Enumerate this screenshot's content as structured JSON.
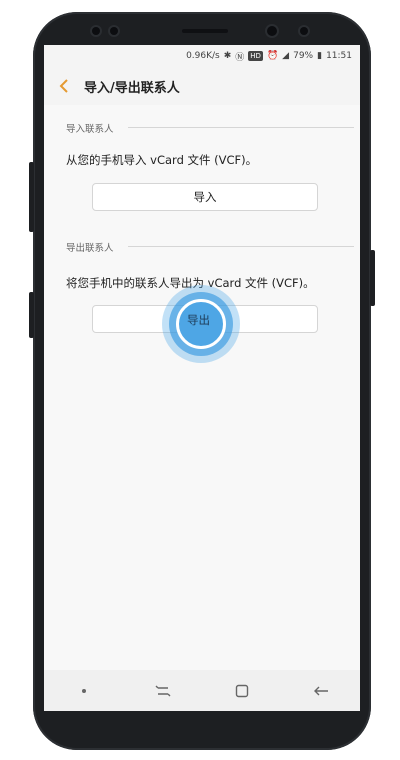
{
  "status_bar": {
    "speed": "0.96K/s",
    "battery": "79%",
    "time": "11:51",
    "hd_badge": "HD",
    "icons": [
      "bluetooth-icon",
      "nfc-icon",
      "hd-icon",
      "alarm-icon",
      "signal-icon",
      "battery-icon"
    ]
  },
  "header": {
    "title": "导入/导出联系人",
    "accent": "#e59a32"
  },
  "import_section": {
    "title": "导入联系人",
    "description": "从您的手机导入 vCard 文件 (VCF)。",
    "button_label": "导入"
  },
  "export_section": {
    "title": "导出联系人",
    "description": "将您手机中的联系人导出为 vCard 文件 (VCF)。",
    "button_label": "导出"
  },
  "navbar": {
    "icons": [
      "dot-icon",
      "recents-icon",
      "home-icon",
      "back-icon"
    ]
  },
  "touch_color": "#4ea6e5"
}
